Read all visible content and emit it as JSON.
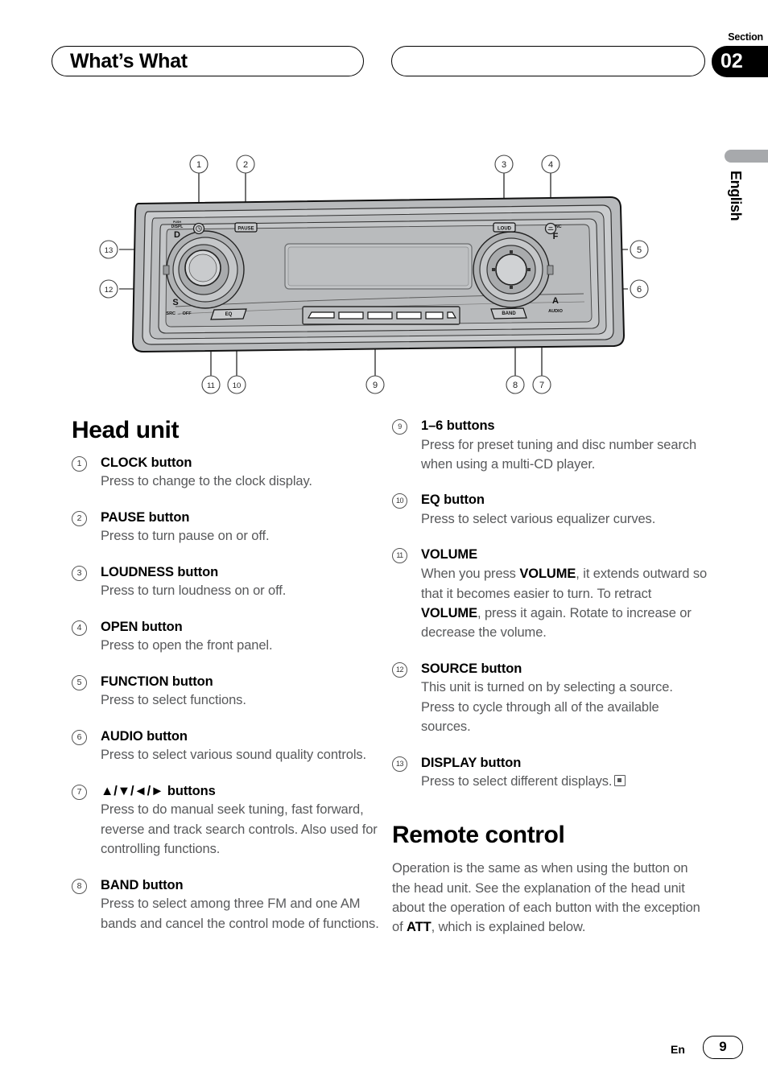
{
  "header": {
    "chapter_title": "What’s What",
    "section_label": "Section",
    "section_number": "02"
  },
  "side": {
    "language": "English"
  },
  "figure": {
    "name": "head-unit-front-panel-diagram",
    "panel_labels": {
      "clock": "⊕",
      "pause": "PAUSE",
      "loudness": "LOUD",
      "open": "⏏",
      "display_top": "DISPL",
      "display_letter": "D",
      "source_letter": "S",
      "source_sub": "SRC ↔ OFF",
      "eq": "EQ",
      "band": "BAND",
      "func_top": "FUNC",
      "func_letter": "F",
      "audio_letter": "A",
      "audio_sub": "AUDIO"
    },
    "callouts": [
      "1",
      "2",
      "3",
      "4",
      "5",
      "6",
      "7",
      "8",
      "9",
      "10",
      "11",
      "12",
      "13"
    ],
    "preset_button_count": 6
  },
  "headings": {
    "head_unit": "Head unit",
    "remote_control": "Remote control"
  },
  "left_column": [
    {
      "num": "1",
      "title": "CLOCK button",
      "body": "Press to change to the clock display."
    },
    {
      "num": "2",
      "title": "PAUSE button",
      "body": "Press to turn pause on or off."
    },
    {
      "num": "3",
      "title": "LOUDNESS button",
      "body": "Press to turn loudness on or off."
    },
    {
      "num": "4",
      "title": "OPEN button",
      "body": "Press to open the front panel."
    },
    {
      "num": "5",
      "title": "FUNCTION button",
      "body": "Press to select functions."
    },
    {
      "num": "6",
      "title": "AUDIO button",
      "body": "Press to select various sound quality controls."
    },
    {
      "num": "7",
      "title": "▲/▼/◄/► buttons",
      "body": "Press to do manual seek tuning, fast forward, reverse and track search controls. Also used for controlling functions."
    },
    {
      "num": "8",
      "title": "BAND button",
      "body": "Press to select among three FM and one AM bands and cancel the control mode of functions."
    }
  ],
  "right_column": [
    {
      "num": "9",
      "title": "1–6 buttons",
      "body": "Press for preset tuning and disc number search when using a multi-CD player."
    },
    {
      "num": "10",
      "title": "EQ button",
      "body": "Press to select various equalizer curves."
    },
    {
      "num": "11",
      "title": "VOLUME",
      "body_parts": [
        {
          "t": "When you press ",
          "b": false
        },
        {
          "t": "VOLUME",
          "b": true
        },
        {
          "t": ", it extends outward so that it becomes easier to turn. To retract ",
          "b": false
        },
        {
          "t": "VOLUME",
          "b": true
        },
        {
          "t": ", press it again. Rotate to increase or decrease the volume.",
          "b": false
        }
      ]
    },
    {
      "num": "12",
      "title": "SOURCE button",
      "body": "This unit is turned on by selecting a source. Press to cycle through all of the available sources."
    },
    {
      "num": "13",
      "title": "DISPLAY button",
      "body": "Press to select different displays.",
      "endmark": true
    }
  ],
  "remote_control_paragraph": [
    {
      "t": "Operation is the same as when using the button on the head unit. See the explanation of the head unit about the operation of each button with the exception of ",
      "b": false
    },
    {
      "t": "ATT",
      "b": true
    },
    {
      "t": ", which is explained below.",
      "b": false
    }
  ],
  "footer": {
    "language_code": "En",
    "page_number": "9"
  }
}
